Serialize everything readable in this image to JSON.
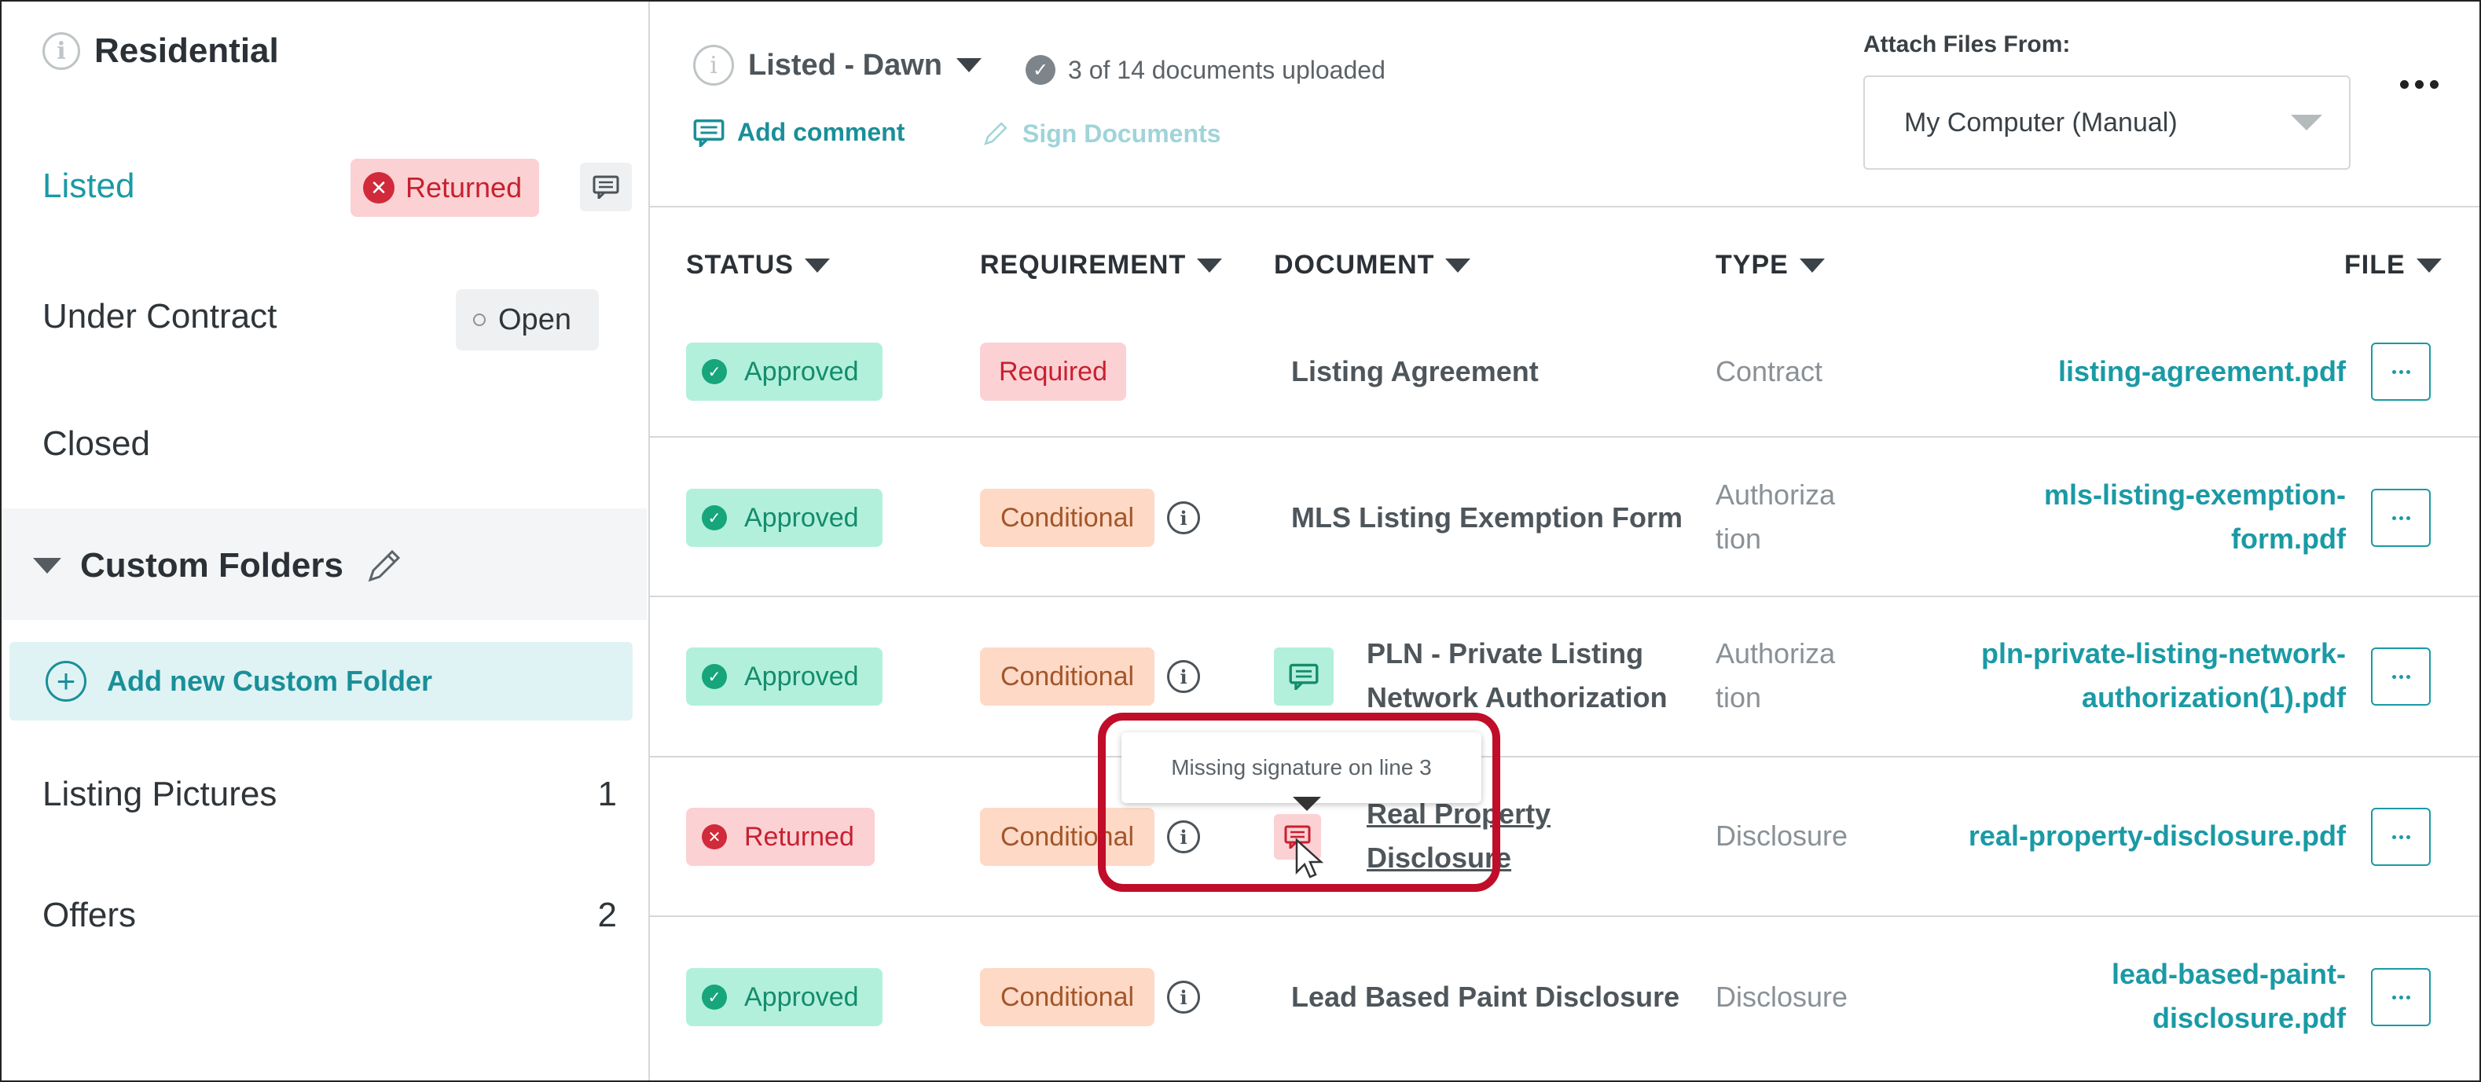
{
  "sidebar": {
    "title": "Residential",
    "stages": [
      {
        "label": "Listed",
        "badge": "Returned"
      },
      {
        "label": "Under Contract",
        "badge": "Open"
      },
      {
        "label": "Closed"
      }
    ],
    "custom_folders_title": "Custom Folders",
    "add_folder_label": "Add new Custom Folder",
    "folders": [
      {
        "label": "Listing Pictures",
        "count": "1"
      },
      {
        "label": "Offers",
        "count": "2"
      }
    ]
  },
  "header": {
    "stage": "Listed - Dawn",
    "docs_status": "3 of 14 documents uploaded",
    "add_comment": "Add comment",
    "sign_documents": "Sign Documents",
    "attach_label": "Attach Files From:",
    "attach_value": "My Computer (Manual)"
  },
  "table": {
    "columns": [
      "STATUS",
      "REQUIREMENT",
      "DOCUMENT",
      "TYPE",
      "FILE"
    ],
    "rows": [
      {
        "status": "Approved",
        "requirement": "Required",
        "document": "Listing Agreement",
        "type": "Contract",
        "file": "listing-agreement.pdf"
      },
      {
        "status": "Approved",
        "requirement": "Conditional",
        "document": "MLS Listing Exemption Form",
        "type_l1": "Authoriza",
        "type_l2": "tion",
        "file_l1": "mls-listing-exemption-",
        "file_l2": "form.pdf"
      },
      {
        "status": "Approved",
        "requirement": "Conditional",
        "doc_l1": "PLN - Private Listing",
        "doc_l2": "Network Authorization",
        "type_l1": "Authoriza",
        "type_l2": "tion",
        "file_l1": "pln-private-listing-network-",
        "file_l2": "authorization(1).pdf"
      },
      {
        "status": "Returned",
        "requirement": "Conditional",
        "doc_l1": "Real Property",
        "doc_l2": "Disclosure",
        "type": "Disclosure",
        "file": "real-property-disclosure.pdf"
      },
      {
        "status": "Approved",
        "requirement": "Conditional",
        "document": "Lead Based Paint Disclosure",
        "type": "Disclosure",
        "file_l1": "lead-based-paint-",
        "file_l2": "disclosure.pdf"
      }
    ]
  },
  "tooltip": {
    "text": "Missing signature on line 3"
  },
  "colors": {
    "accent": "#1a9aa5",
    "approved": "#b2f0dc",
    "returned": "#fbd1d4",
    "conditional": "#fdd9c6",
    "highlight": "#c00d2a"
  },
  "icons": [
    "info-icon",
    "x-circle-icon",
    "comment-icon",
    "check-circle-icon",
    "caret-down-icon",
    "pencil-icon",
    "plus-circle-icon",
    "pen-icon",
    "kebab-icon",
    "more-icon",
    "cursor-icon"
  ]
}
